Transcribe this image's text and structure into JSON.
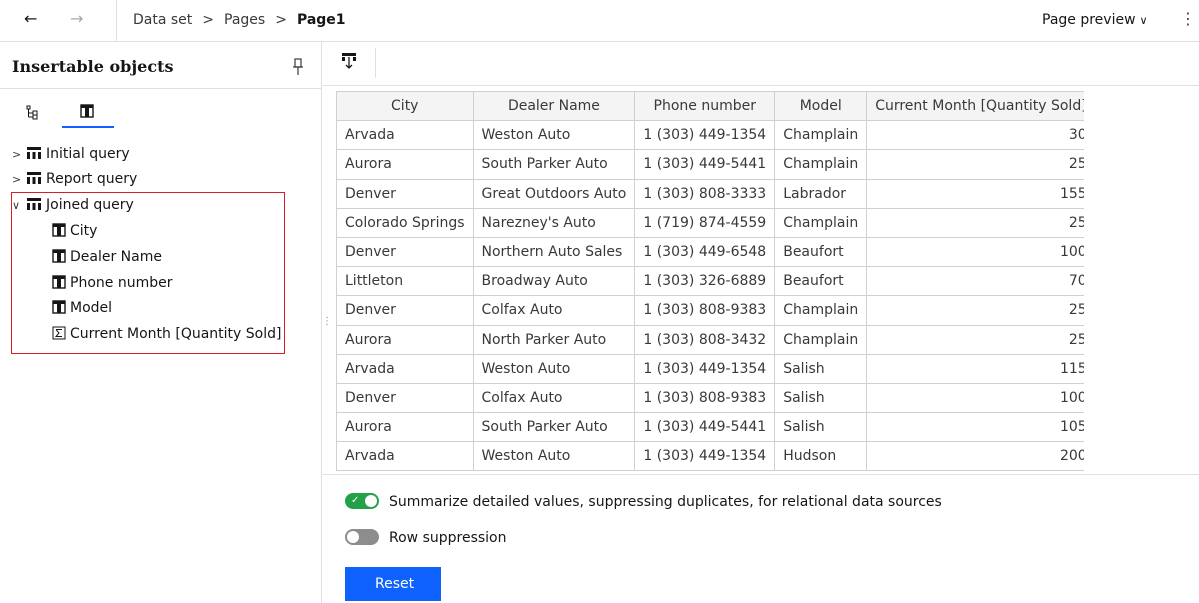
{
  "topbar": {
    "breadcrumbs": [
      "Data set",
      "Pages"
    ],
    "current_page": "Page1",
    "preview_label": "Page preview"
  },
  "left_panel": {
    "title": "Insertable objects",
    "tree": [
      {
        "label": "Initial query",
        "type": "query",
        "expanded": false
      },
      {
        "label": "Report query",
        "type": "query",
        "expanded": false
      },
      {
        "label": "Joined query",
        "type": "query",
        "expanded": true,
        "children": [
          {
            "label": "City",
            "type": "column"
          },
          {
            "label": "Dealer Name",
            "type": "column"
          },
          {
            "label": "Phone number",
            "type": "column"
          },
          {
            "label": "Model",
            "type": "column"
          },
          {
            "label": "Current Month [Quantity Sold]",
            "type": "measure"
          }
        ]
      }
    ]
  },
  "table": {
    "headers": [
      "City",
      "Dealer Name",
      "Phone number",
      "Model",
      "Current Month [Quantity Sold]"
    ],
    "rows": [
      [
        "Arvada",
        "Weston Auto",
        "1 (303) 449-1354",
        "Champlain",
        "30"
      ],
      [
        "Aurora",
        "South Parker Auto",
        "1 (303) 449-5441",
        "Champlain",
        "25"
      ],
      [
        "Denver",
        "Great Outdoors Auto",
        "1 (303) 808-3333",
        "Labrador",
        "155"
      ],
      [
        "Colorado Springs",
        "Narezney's Auto",
        "1 (719) 874-4559",
        "Champlain",
        "25"
      ],
      [
        "Denver",
        "Northern Auto Sales",
        "1 (303) 449-6548",
        "Beaufort",
        "100"
      ],
      [
        "Littleton",
        "Broadway Auto",
        "1 (303) 326-6889",
        "Beaufort",
        "70"
      ],
      [
        "Denver",
        "Colfax Auto",
        "1 (303) 808-9383",
        "Champlain",
        "25"
      ],
      [
        "Aurora",
        "North Parker Auto",
        "1 (303) 808-3432",
        "Champlain",
        "25"
      ],
      [
        "Arvada",
        "Weston Auto",
        "1 (303) 449-1354",
        "Salish",
        "115"
      ],
      [
        "Denver",
        "Colfax Auto",
        "1 (303) 808-9383",
        "Salish",
        "100"
      ],
      [
        "Aurora",
        "South Parker Auto",
        "1 (303) 449-5441",
        "Salish",
        "105"
      ],
      [
        "Arvada",
        "Weston Auto",
        "1 (303) 449-1354",
        "Hudson",
        "200"
      ]
    ]
  },
  "options": {
    "summarize_label": "Summarize detailed values, suppressing duplicates, for relational data sources",
    "summarize_on": true,
    "row_suppression_label": "Row suppression",
    "row_suppression_on": false
  },
  "reset_label": "Reset",
  "colors": {
    "accent": "#0f62fe",
    "toggle_on": "#24a148",
    "toggle_off": "#8d8d8d",
    "highlight": "#da1e28"
  }
}
